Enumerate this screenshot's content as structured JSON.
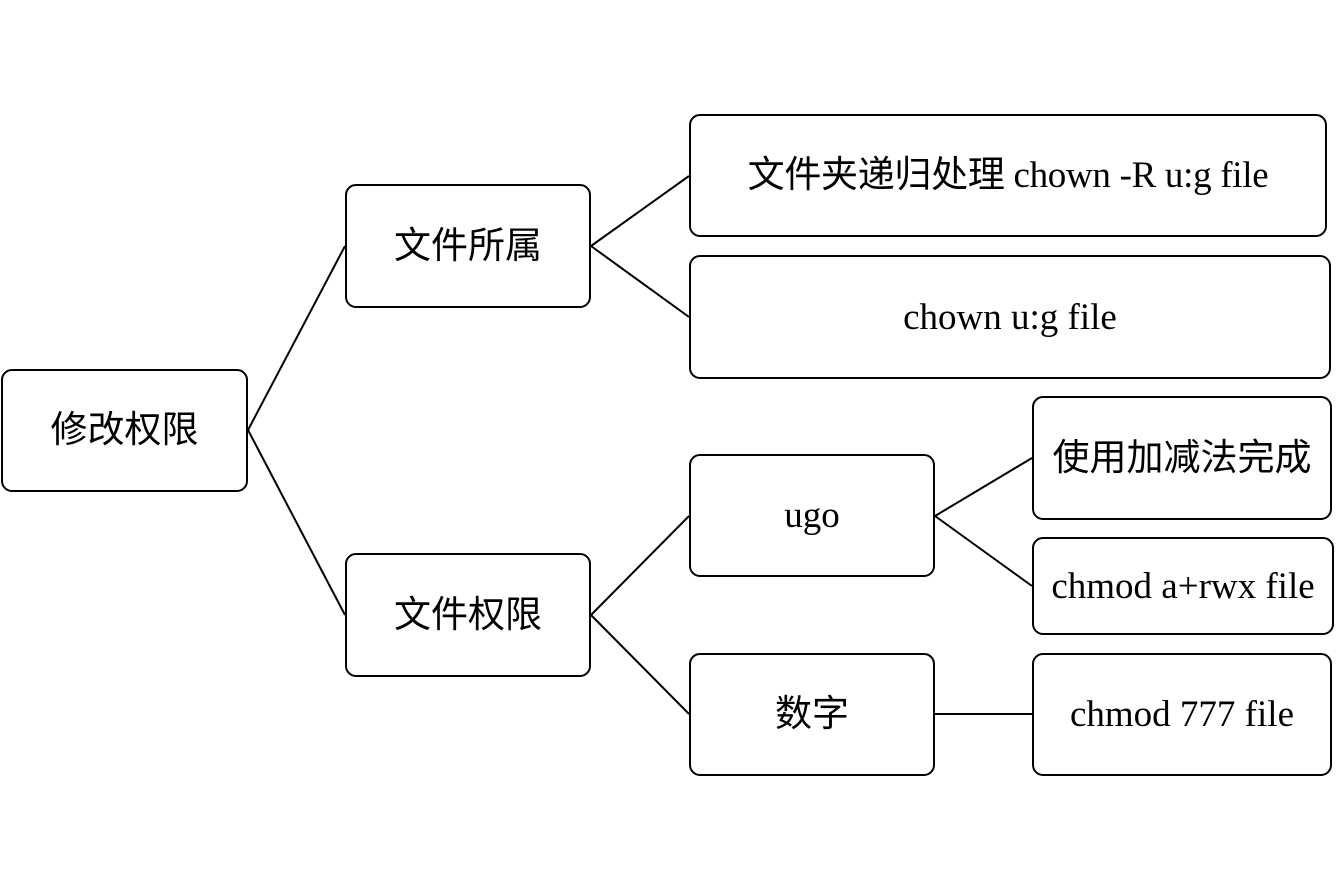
{
  "diagram": {
    "root": {
      "label": "修改权限"
    },
    "owner": {
      "label": "文件所属",
      "children": {
        "recursive": "文件夹递归处理 chown -R u:g file",
        "chown": "chown u:g file"
      }
    },
    "permission": {
      "label": "文件权限",
      "ugo": {
        "label": "ugo",
        "children": {
          "add_sub": "使用加减法完成",
          "chmod_a": "chmod a+rwx file"
        }
      },
      "number": {
        "label": "数字",
        "children": {
          "chmod_777": "chmod 777 file"
        }
      }
    }
  }
}
